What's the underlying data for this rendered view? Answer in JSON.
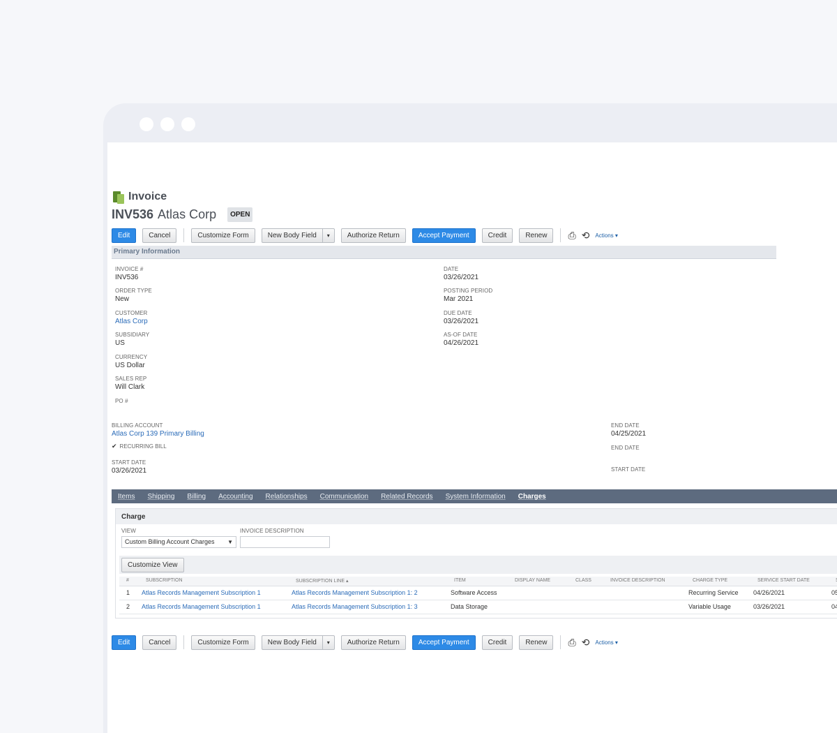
{
  "record": {
    "type": "Invoice",
    "number": "INV536",
    "customer": "Atlas Corp",
    "status": "OPEN"
  },
  "toolbar": {
    "edit": "Edit",
    "cancel": "Cancel",
    "customize_form": "Customize Form",
    "new_body_field": "New Body Field",
    "split_caret": "▾",
    "authorize_return": "Authorize Return",
    "accept_payment": "Accept Payment",
    "credit": "Credit",
    "renew": "Renew",
    "print_icon": "⎙",
    "email_icon": "⟲",
    "actions": "Actions ▾"
  },
  "primary_section": "Primary Information",
  "fields_left": [
    {
      "label": "INVOICE #",
      "value": "INV536"
    },
    {
      "label": "ORDER TYPE",
      "value": "New"
    },
    {
      "label": "CUSTOMER",
      "value": "Atlas Corp"
    },
    {
      "label": "SUBSIDIARY",
      "value": "US"
    },
    {
      "label": "CURRENCY",
      "value": "US Dollar"
    },
    {
      "label": "SALES REP",
      "value": "Will Clark"
    },
    {
      "label": "PO #",
      "value": ""
    }
  ],
  "fields_right": [
    {
      "label": "DATE",
      "value": "03/26/2021"
    },
    {
      "label": "POSTING PERIOD",
      "value": "Mar 2021"
    },
    {
      "label": "DUE DATE",
      "value": "03/26/2021"
    },
    {
      "label": "AS-OF DATE",
      "value": "04/26/2021"
    }
  ],
  "billing": {
    "account_label": "BILLING ACCOUNT",
    "account_value": "Atlas Corp 139 Primary Billing",
    "recurring_label": "RECURRING BILL",
    "start_label": "START DATE",
    "start_value": "03/26/2021",
    "end_label_1": "END DATE",
    "end_value_1": "04/25/2021",
    "end_label_2": "END DATE",
    "start_label_right": "START DATE"
  },
  "tabs": [
    "Items",
    "Shipping",
    "Billing",
    "Accounting",
    "Relationships",
    "Communication",
    "Related Records",
    "System Information",
    "Charges"
  ],
  "charges": {
    "header": "Charge",
    "view_label": "VIEW",
    "view_value": "Custom Billing Account Charges",
    "invoice_desc_label": "INVOICE DESCRIPTION",
    "customize_view": "Customize View",
    "columns": [
      "#",
      "SUBSCRIPTION",
      "SUBSCRIPTION LINE ▴",
      "ITEM",
      "DISPLAY NAME",
      "CLASS",
      "INVOICE DESCRIPTION",
      "CHARGE TYPE",
      "SERVICE START DATE",
      "S"
    ],
    "rows": [
      {
        "n": "1",
        "subscription": "Atlas Records Management Subscription 1",
        "line": "Atlas Records Management Subscription 1: 2",
        "item": "Software Access",
        "charge_type": "Recurring Service",
        "start": "04/26/2021",
        "extra": "05"
      },
      {
        "n": "2",
        "subscription": "Atlas Records Management Subscription 1",
        "line": "Atlas Records Management Subscription 1: 3",
        "item": "Data Storage",
        "charge_type": "Variable Usage",
        "start": "03/26/2021",
        "extra": "04"
      }
    ]
  }
}
